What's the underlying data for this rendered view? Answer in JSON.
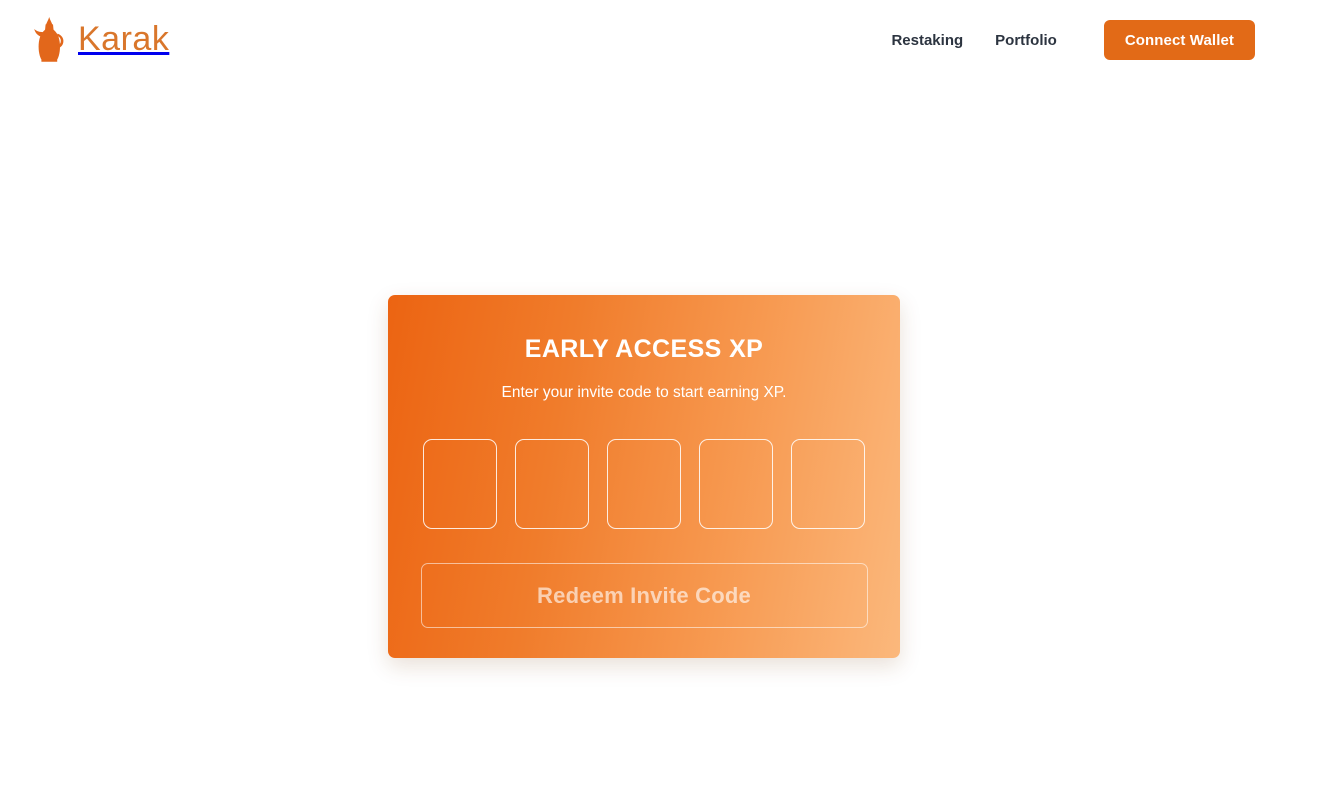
{
  "theme": {
    "page_background": "#ffffff",
    "brand_orange": "#D9762B",
    "accent_orange": "#E26A17",
    "nav_text": "#2C3440",
    "card_gradient_from": "#EC6412",
    "card_gradient_to": "#FBB87C",
    "card_text": "#ffffff"
  },
  "header": {
    "logo_icon": "dallah-coffee-pot-icon",
    "brand_name": "Karak",
    "nav": [
      {
        "label": "Restaking",
        "name": "nav-link-restaking"
      },
      {
        "label": "Portfolio",
        "name": "nav-link-portfolio"
      }
    ],
    "connect_wallet_label": "Connect Wallet"
  },
  "card": {
    "title": "EARLY ACCESS XP",
    "subtitle": "Enter your invite code to start earning XP.",
    "invite_code": {
      "length": 5,
      "values": [
        "",
        "",
        "",
        "",
        ""
      ],
      "placeholder": ""
    },
    "redeem_label": "Redeem Invite Code",
    "redeem_disabled": true
  }
}
